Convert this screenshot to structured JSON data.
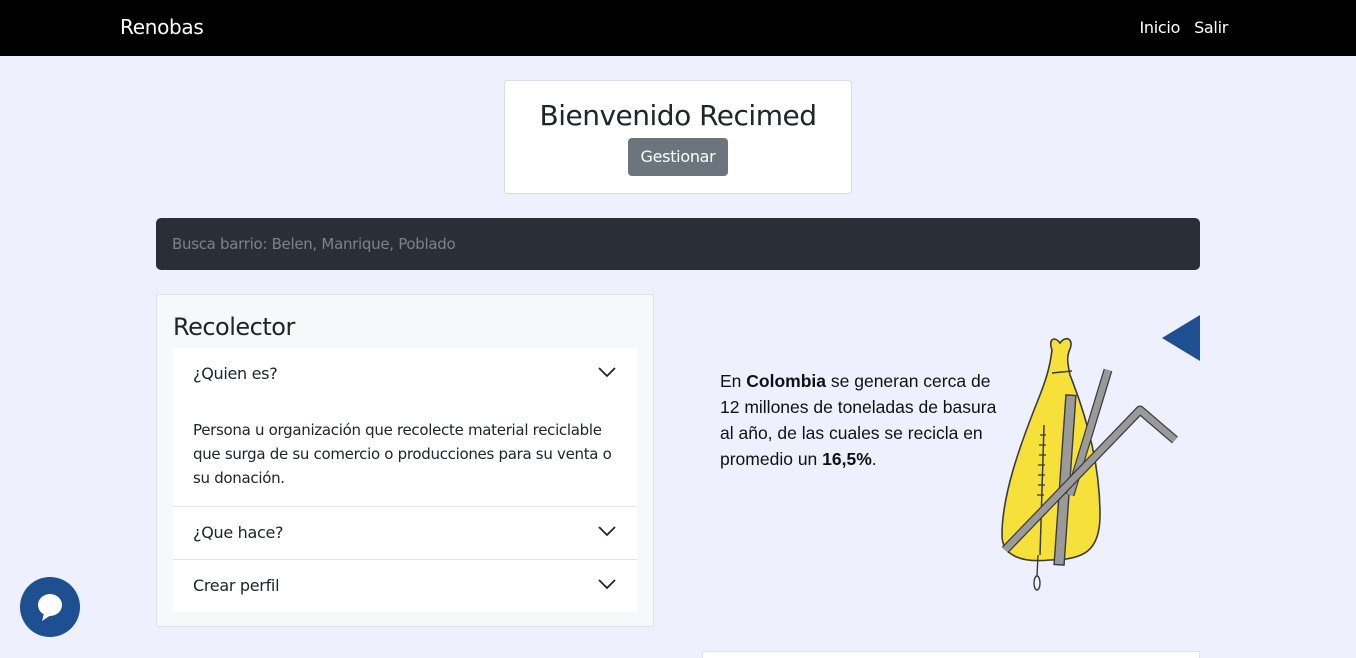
{
  "navbar": {
    "brand": "Renobas",
    "links": [
      "Inicio",
      "Salir"
    ]
  },
  "welcome": {
    "title": "Bienvenido Recimed",
    "button_label": "Gestionar"
  },
  "search": {
    "placeholder": "Busca barrio: Belen, Manrique, Poblado",
    "value": ""
  },
  "recolector": {
    "title": "Recolector",
    "items": [
      {
        "label": "¿Quien es?",
        "expanded": true,
        "body": "Persona u organización que recolecte material reciclable que surga de su comercio o producciones para su venta o su donación."
      },
      {
        "label": "¿Que hace?",
        "expanded": false
      },
      {
        "label": "Crear perfil",
        "expanded": false
      }
    ]
  },
  "info": {
    "text_1": "En ",
    "bold_1": "Colombia",
    "text_2": " se generan cerca de 12 millones de toneladas de basura al año, de las cuales se recicla en promedio un ",
    "bold_2": "16,5%",
    "text_3": "."
  },
  "icons": {
    "chevron": "chevron-down-icon",
    "chat": "chat-icon",
    "carousel_prev": "triangle-left-icon"
  },
  "colors": {
    "navbar_bg": "#000000",
    "page_bg": "#eef0fe",
    "search_bg": "#2a2e36",
    "button_bg": "#6c757d",
    "chat_bg": "#1d4f91",
    "accent_blue": "#1d4f91",
    "illustration_yellow": "#f5e13a"
  }
}
